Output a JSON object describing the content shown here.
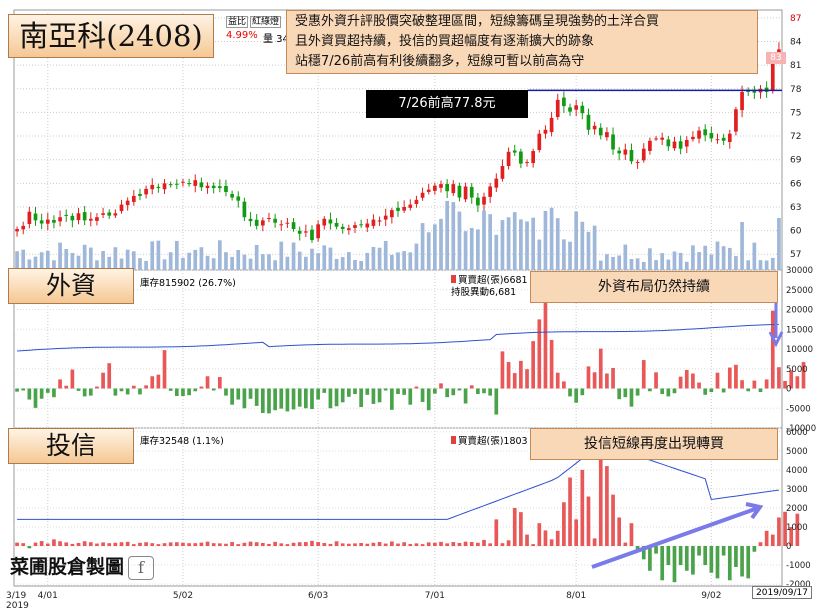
{
  "header": {
    "title": "南亞科(2408)",
    "tabs": [
      "益比",
      "紅綠燈"
    ],
    "pct_change": "4.99%",
    "vol_label": "量 34"
  },
  "annotation": {
    "lines": [
      "受惠外資升評股價突破整理區間，短線籌碼呈現強勢的土洋合買",
      "且外資買超持續，投信的買超幅度有逐漸擴大的跡象",
      "站穩7/26前高有利後續翻多，短線可暫以前高為守"
    ]
  },
  "peak_label": "7/26前高77.8元",
  "price_badge": "83",
  "foreign": {
    "label": "外資",
    "hold_text": "庫存815902 (26.7%)",
    "buy_text": "買賣超(張)6681",
    "change_text": "持股異動6,681",
    "banner": "外資布局仍然持續"
  },
  "trust": {
    "label": "投信",
    "hold_text": "庫存32548 (1.1%)",
    "buy_text": "買賣超(張)1803",
    "banner": "投信短線再度出現轉買"
  },
  "watermark": {
    "text": "菜圃股倉製圖",
    "icon": "facebook-icon"
  },
  "date_badge": "2019/09/17",
  "chart_data": [
    {
      "type": "candlestick",
      "x_ticks": [
        "3/19\n2019",
        "4/01",
        "5/02",
        "6/03",
        "7/01",
        "8/01",
        "9/02"
      ],
      "y_ticks": [
        57,
        60,
        63,
        66,
        69,
        72,
        75,
        78,
        81,
        84,
        87
      ],
      "ylim": [
        55,
        88
      ],
      "reference_line": 77.8,
      "grid": true,
      "close": [
        60.2,
        60.6,
        62.4,
        61.3,
        60.9,
        61.4,
        61.0,
        61.7,
        61.9,
        61.3,
        62.2,
        61.3,
        61.5,
        61.7,
        62.2,
        61.9,
        62.2,
        63.3,
        63.8,
        64.4,
        64.4,
        65.3,
        65.8,
        65.4,
        66.0,
        65.8,
        65.9,
        66.2,
        65.9,
        66.4,
        65.5,
        65.7,
        65.4,
        65.4,
        64.9,
        64.2,
        63.8,
        61.7,
        61.2,
        60.6,
        61.3,
        61.6,
        61.0,
        60.8,
        61.0,
        60.2,
        59.6,
        59.9,
        58.8,
        60.8,
        61.5,
        60.9,
        60.5,
        60.2,
        60.3,
        60.7,
        60.7,
        60.9,
        61.4,
        61.3,
        61.9,
        62.6,
        62.5,
        63.0,
        63.3,
        63.9,
        64.8,
        65.2,
        65.7,
        65.9,
        65.0,
        65.9,
        64.2,
        65.6,
        64.2,
        63.2,
        64.3,
        65.6,
        66.6,
        68.2,
        70.0,
        69.9,
        68.5,
        68.7,
        70.1,
        72.3,
        72.8,
        74.3,
        76.6,
        75.8,
        75.1,
        75.9,
        74.9,
        72.8,
        73.3,
        72.1,
        72.5,
        70.3,
        69.8,
        70.3,
        68.8,
        68.7,
        70.4,
        71.4,
        71.7,
        71.8,
        70.7,
        71.3,
        70.4,
        71.5,
        71.9,
        72.7,
        72.1,
        71.7,
        71.6,
        71.4,
        72.3,
        75.4,
        77.6,
        77.6,
        77.5,
        78.0,
        77.6,
        81.6,
        83.0
      ],
      "volume_ylim": [
        0,
        100
      ]
    },
    {
      "type": "bar",
      "series": [
        {
          "name": "買賣超(張)"
        },
        {
          "name": "庫存"
        }
      ],
      "y_ticks": [
        -10000,
        -5000,
        0,
        5000,
        10000,
        15000,
        20000,
        25000,
        30000
      ],
      "ylim": [
        -10000,
        30000
      ],
      "values": [
        -800,
        -500,
        -2800,
        -4900,
        -2600,
        -1100,
        -2200,
        2300,
        700,
        4800,
        -600,
        -2000,
        -1800,
        500,
        4000,
        6400,
        -1800,
        -700,
        -1500,
        700,
        -1500,
        800,
        3100,
        3500,
        9700,
        -600,
        -1900,
        -1900,
        -1700,
        -700,
        500,
        3100,
        -500,
        2900,
        -1800,
        -4100,
        -2800,
        -5000,
        -2600,
        -4400,
        -6200,
        -6300,
        -5500,
        -5100,
        -5800,
        -5300,
        -4600,
        -5000,
        -5200,
        -2800,
        -1100,
        -5000,
        -4500,
        -3500,
        -2100,
        -1400,
        -4700,
        -1600,
        -3900,
        -3500,
        -500,
        -5400,
        -1400,
        -1600,
        -4100,
        500,
        -3400,
        -5500,
        -1300,
        1300,
        -2200,
        -1700,
        -500,
        -3800,
        800,
        -1400,
        -1200,
        -1800,
        -6600,
        9400,
        6700,
        3900,
        7000,
        4900,
        12000,
        17500,
        22500,
        12300,
        4000,
        1800,
        -2000,
        -3600,
        -1700,
        5600,
        4100,
        10100,
        3800,
        5200,
        -2700,
        -2200,
        -4600,
        -1800,
        7200,
        -700,
        4100,
        -1400,
        -2000,
        -1200,
        3000,
        4700,
        3800,
        1500,
        -1600,
        -900,
        4000,
        -1000,
        5300,
        6000,
        2100,
        -700,
        2000,
        -900,
        2300,
        19700,
        5400,
        1900,
        4600,
        3100,
        6700
      ],
      "holding_ylim": [
        790000,
        830000
      ]
    },
    {
      "type": "bar",
      "series": [
        {
          "name": "買賣超(張)"
        },
        {
          "name": "庫存"
        }
      ],
      "y_ticks": [
        -2000,
        -1000,
        0,
        1000,
        2000,
        3000,
        4000,
        5000,
        6000
      ],
      "ylim": [
        -2100,
        6200
      ],
      "values": [
        180,
        150,
        -120,
        180,
        260,
        130,
        350,
        250,
        190,
        110,
        160,
        250,
        200,
        130,
        190,
        150,
        170,
        200,
        220,
        100,
        170,
        200,
        150,
        100,
        150,
        190,
        200,
        170,
        150,
        150,
        180,
        230,
        150,
        140,
        120,
        210,
        100,
        170,
        230,
        200,
        160,
        110,
        220,
        140,
        100,
        170,
        200,
        210,
        270,
        210,
        160,
        110,
        250,
        140,
        120,
        140,
        160,
        120,
        170,
        210,
        130,
        240,
        130,
        200,
        110,
        140,
        100,
        190,
        170,
        220,
        140,
        210,
        160,
        230,
        210,
        170,
        320,
        140,
        1400,
        150,
        300,
        2000,
        1780,
        600,
        100,
        1200,
        820,
        350,
        800,
        2300,
        3600,
        1400,
        4000,
        2600,
        400,
        4900,
        4200,
        2700,
        1500,
        180,
        1200,
        -300,
        -700,
        -1300,
        -400,
        -1800,
        -1000,
        -1900,
        -1000,
        -1300,
        -1500,
        -500,
        -1000,
        -1400,
        -1700,
        -500,
        -1800,
        -1100,
        -1600,
        -1700,
        -300,
        200,
        800,
        600,
        1500,
        1800,
        1000,
        1700
      ],
      "holding_ylim": [
        27000,
        36000
      ]
    }
  ]
}
